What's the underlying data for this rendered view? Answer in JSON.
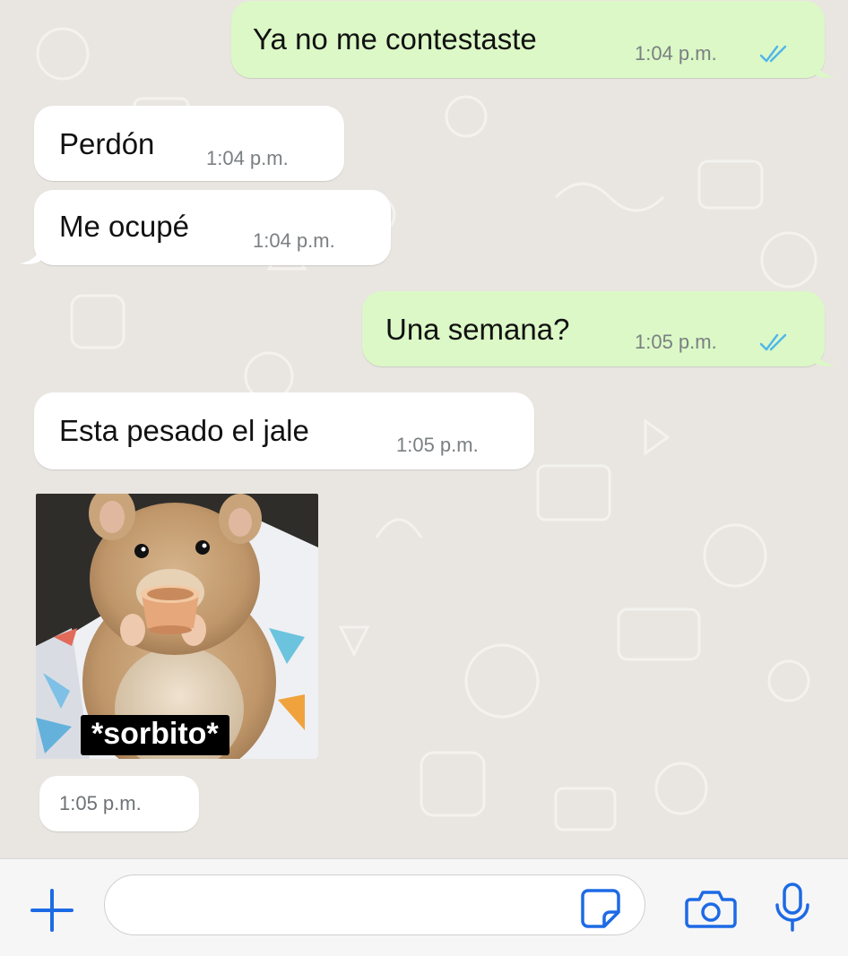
{
  "colors": {
    "chat_background": "#e9e6e1",
    "outgoing_bubble": "#dbf8c6",
    "incoming_bubble": "#ffffff",
    "read_ticks": "#4fb6ec",
    "accent_icons": "#1d6ae5"
  },
  "messages": [
    {
      "direction": "outgoing",
      "text": "Ya no me contestaste",
      "time": "1:04 p.m.",
      "status_icon": "double-check-read-icon"
    },
    {
      "direction": "incoming",
      "text": "Perdón",
      "time": "1:04 p.m."
    },
    {
      "direction": "incoming",
      "text": "Me ocupé",
      "time": "1:04 p.m."
    },
    {
      "direction": "outgoing",
      "text": "Una semana?",
      "time": "1:05 p.m.",
      "status_icon": "double-check-read-icon"
    },
    {
      "direction": "incoming",
      "text": "Esta pesado el jale",
      "time": "1:05 p.m."
    }
  ],
  "sticker": {
    "caption": "*sorbito*",
    "time": "1:05 p.m."
  },
  "composer": {
    "add_icon": "plus-icon",
    "sticker_icon": "sticker-icon",
    "camera_icon": "camera-icon",
    "mic_icon": "microphone-icon"
  }
}
